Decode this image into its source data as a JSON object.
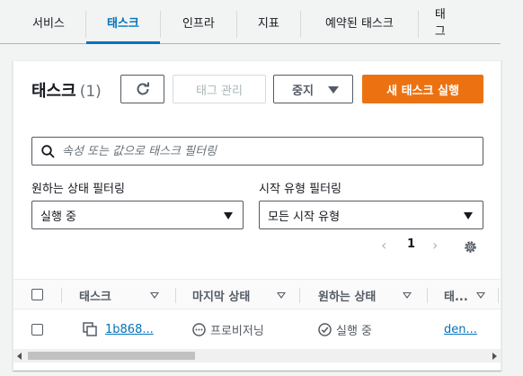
{
  "tabs": [
    "서비스",
    "태스크",
    "인프라",
    "지표",
    "예약된 태스크",
    "태그"
  ],
  "active_tab": "태스크",
  "panel": {
    "title": "태스크",
    "count": "(1)",
    "buttons": {
      "refresh_icon": "refresh-icon",
      "manage_tags": "태그 관리",
      "stop": "중지",
      "run_new_task": "새 태스크 실행"
    }
  },
  "search": {
    "placeholder": "속성 또는 값으로 태스크 필터링",
    "value": ""
  },
  "filters": {
    "desired_status": {
      "label": "원하는 상태 필터링",
      "value": "실행 중"
    },
    "launch_type": {
      "label": "시작 유형 필터링",
      "value": "모든 시작 유형"
    }
  },
  "pagination": {
    "page": "1"
  },
  "table": {
    "columns": [
      "태스크",
      "마지막 상태",
      "원하는 상태",
      "태..."
    ],
    "rows": [
      {
        "task": "1b868...",
        "last_status": "프로비저닝",
        "desired_status": "실행 중",
        "task_def": "den..."
      }
    ]
  },
  "colors": {
    "accent": "#0073bb",
    "primary_button": "#ec7211"
  }
}
